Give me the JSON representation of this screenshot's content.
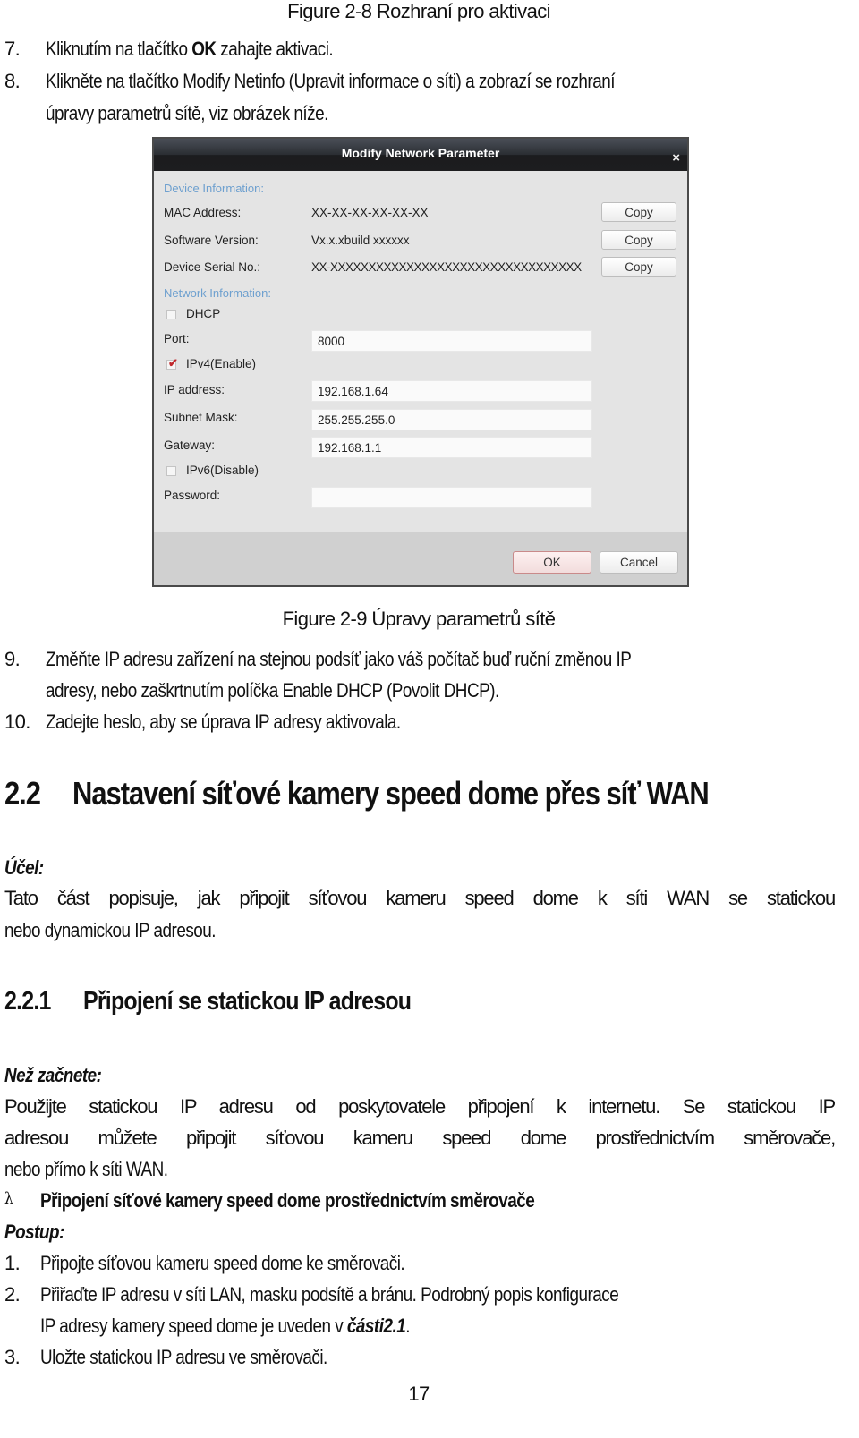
{
  "captions": {
    "fig_2_8": "Figure 2-8 Rozhraní pro aktivaci",
    "fig_2_9": "Figure 2-9 Úpravy parametrů sítě"
  },
  "steps_top": [
    {
      "num": "7.",
      "before": "Kliknutím na tlačítko ",
      "bold": "OK",
      "after": " zahajte aktivaci."
    },
    {
      "num": "8.",
      "line1": "Klikněte na tlačítko Modify Netinfo (Upravit informace o síti) a zobrazí se rozhraní",
      "line2": "úpravy parametrů sítě, viz obrázek níže."
    }
  ],
  "dialog": {
    "title": "Modify Network Parameter",
    "close_icon": "×",
    "device_info_heading": "Device Information:",
    "mac_label": "MAC Address:",
    "mac_value": "XX-XX-XX-XX-XX-XX",
    "sw_label": "Software Version:",
    "sw_value": "Vx.x.xbuild xxxxxx",
    "serial_label": "Device Serial No.:",
    "serial_value": "XX-XXXXXXXXXXXXXXXXXXXXXXXXXXXXXXXXX",
    "copy_label": "Copy",
    "network_info_heading": "Network Information:",
    "dhcp_label": "DHCP",
    "dhcp_checked": false,
    "port_label": "Port:",
    "port_value": "8000",
    "ipv4_label": "IPv4(Enable)",
    "ipv4_checked": true,
    "check_mark": "✔",
    "ip_label": "IP address:",
    "ip_value": "192.168.1.64",
    "mask_label": "Subnet Mask:",
    "mask_value": "255.255.255.0",
    "gateway_label": "Gateway:",
    "gateway_value": "192.168.1.1",
    "ipv6_label": "IPv6(Disable)",
    "ipv6_checked": false,
    "password_label": "Password:",
    "password_value": "",
    "ok_label": "OK",
    "cancel_label": "Cancel"
  },
  "steps_mid": [
    {
      "num": "9.",
      "line1": "Změňte IP adresu zařízení na stejnou podsíť jako váš počítač buď ruční změnou IP",
      "line2": "adresy, nebo zaškrtnutím políčka Enable DHCP (Povolit DHCP)."
    },
    {
      "num": "10.",
      "line1": "Zadejte heslo, aby se úprava IP adresy aktivovala."
    }
  ],
  "section_2_2": {
    "number": "2.2",
    "title": "Nastavení síťové kamery speed dome přes síť WAN",
    "purpose_label": "Účel:",
    "purpose_line1": "Tato část popisuje, jak připojit síťovou kameru speed dome k síti WAN se statickou",
    "purpose_line2": "nebo dynamickou IP adresou."
  },
  "section_2_2_1": {
    "number": "2.2.1",
    "title": "Připojení se statickou IP adresou",
    "before_label": "Než začnete:",
    "before_line1": "Použijte statickou IP adresu od poskytovatele připojení k internetu. Se statickou IP",
    "before_line2": "adresou můžete připojit síťovou kameru speed dome prostřednictvím směrovače,",
    "before_line3": "nebo přímo k síti WAN.",
    "bullet_symbol": "λ",
    "bullet_text": "Připojení síťové kamery speed dome prostřednictvím směrovače",
    "procedure_label": "Postup:",
    "steps": [
      {
        "num": "1.",
        "line1": "Připojte síťovou kameru speed dome ke směrovači."
      },
      {
        "num": "2.",
        "line1": "Přiřaďte IP adresu v síti LAN, masku podsítě a bránu. Podrobný popis konfigurace",
        "line2_before": "IP adresy kamery speed dome je uveden v ",
        "line2_bold": "části2.1",
        "line2_after": "."
      },
      {
        "num": "3.",
        "line1": "Uložte statickou IP adresu ve směrovači."
      }
    ]
  },
  "page_number": "17"
}
